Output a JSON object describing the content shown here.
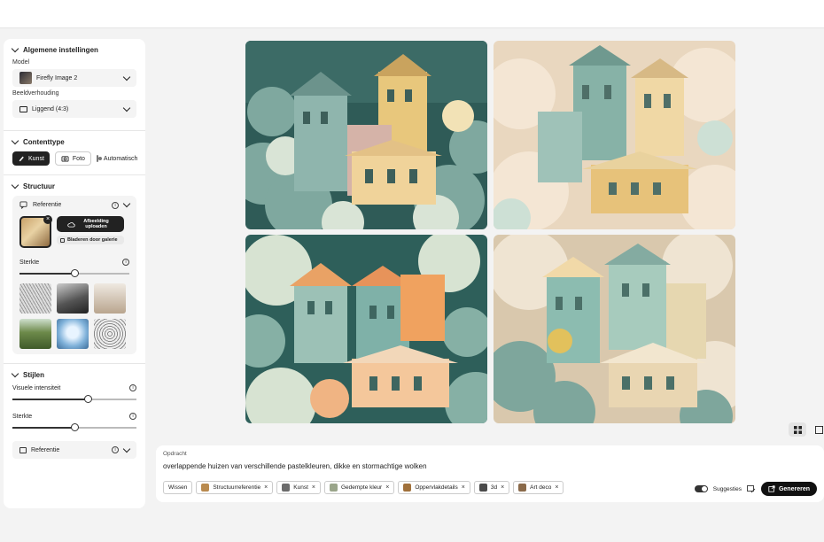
{
  "sidebar": {
    "general_title": "Algemene instellingen",
    "model_label": "Model",
    "model_value": "Firefly Image 2",
    "ratio_label": "Beeldverhouding",
    "ratio_value": "Liggend (4:3)",
    "content_title": "Contenttype",
    "content_art": "Kunst",
    "content_photo": "Foto",
    "content_auto": "Automatisch",
    "structure_title": "Structuur",
    "reference_label": "Referentie",
    "upload_label": "Afbeelding uploaden",
    "gallery_label": "Bladeren door galerie",
    "strength_label": "Sterkte",
    "strength_value": 0.5,
    "styles_title": "Stijlen",
    "visual_intensity_label": "Visuele intensiteit",
    "visual_intensity_value": 0.6,
    "styles_strength_label": "Sterkte",
    "styles_strength_value": 0.5,
    "reference_label_2": "Referentie"
  },
  "prompt": {
    "label": "Opdracht",
    "text": "overlappende huizen van verschillende pastelkleuren, dikke en stormachtige wolken",
    "clear_label": "Wissen",
    "chips": [
      {
        "label": "Structuurreferentie",
        "color": "#b98a4e"
      },
      {
        "label": "Kunst",
        "color": "#6b6b6b"
      },
      {
        "label": "Gedempte kleur",
        "color": "#9aa58a"
      },
      {
        "label": "Oppervlakdetails",
        "color": "#a0703a"
      },
      {
        "label": "3d",
        "color": "#4a4a4a"
      },
      {
        "label": "Art deco",
        "color": "#8a6a4a"
      }
    ],
    "suggestions_label": "Suggesties",
    "generate_label": "Genereren"
  },
  "colors": {
    "accent": "#111111",
    "teal": "#6e9e96",
    "peach": "#f0c9a0",
    "orange": "#e7a06a",
    "yellow": "#e9c77e"
  }
}
